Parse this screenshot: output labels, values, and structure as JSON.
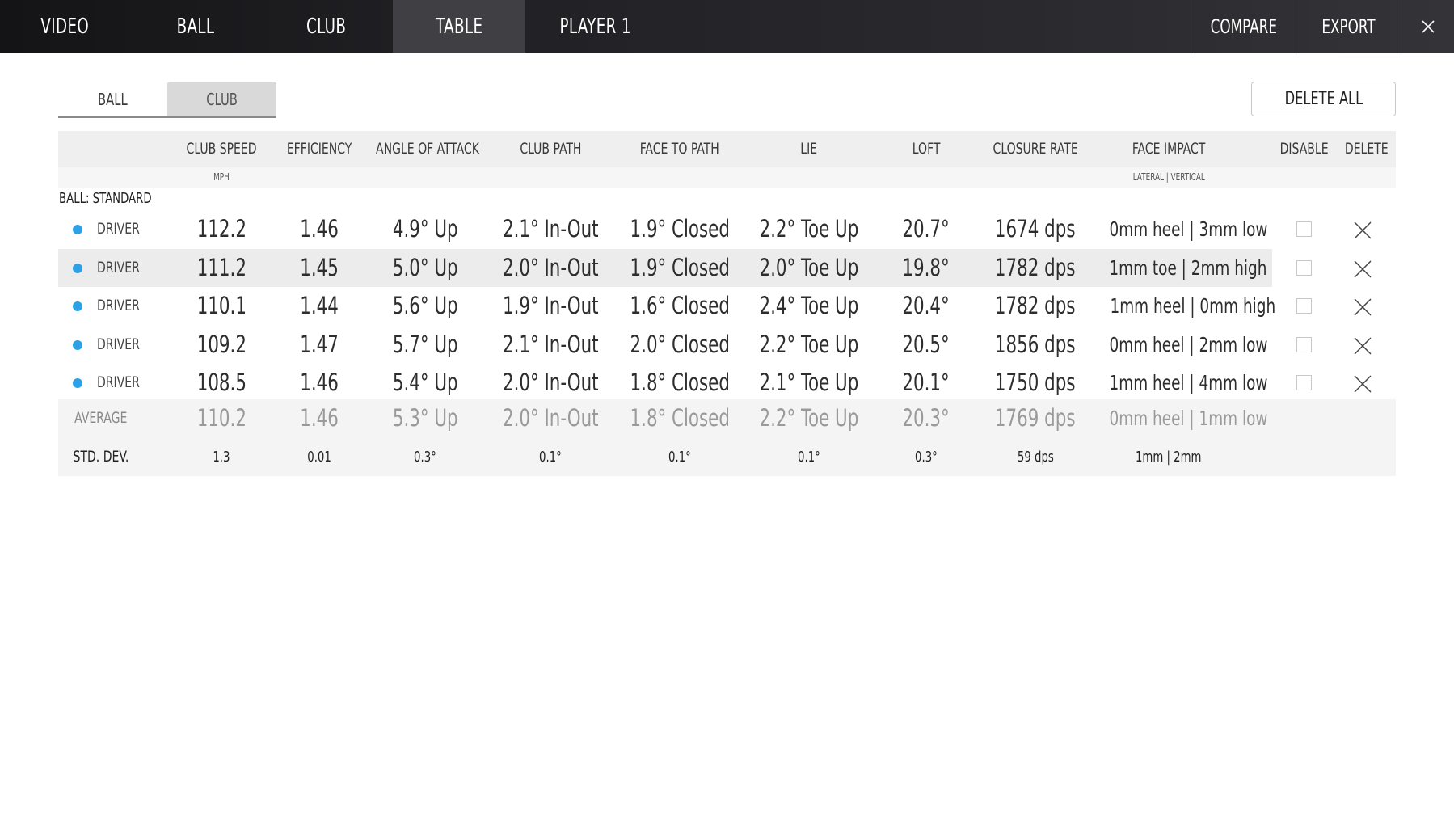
{
  "nav": {
    "tabs": [
      "VIDEO",
      "BALL",
      "CLUB",
      "TABLE",
      "PLAYER 1"
    ],
    "active": "TABLE",
    "compare": "COMPARE",
    "export": "EXPORT",
    "close_icon": "close-icon"
  },
  "subtabs": {
    "ball": "BALL",
    "club": "CLUB",
    "active": "CLUB"
  },
  "delete_all": "DELETE ALL",
  "table": {
    "headers": [
      "CLUB SPEED",
      "EFFICIENCY",
      "ANGLE OF ATTACK",
      "CLUB PATH",
      "FACE TO PATH",
      "LIE",
      "LOFT",
      "CLOSURE RATE",
      "FACE IMPACT",
      "DISABLE",
      "DELETE"
    ],
    "units": {
      "club_speed": "MPH",
      "face_impact": "LATERAL | VERTICAL"
    },
    "group": "BALL: STANDARD",
    "dot_color": "#2ba1e6",
    "rows": [
      {
        "club": "DRIVER",
        "club_speed": "112.2",
        "efficiency": "1.46",
        "aoa": "4.9° Up",
        "club_path": "2.1° In-Out",
        "face_to_path": "1.9° Closed",
        "lie": "2.2° Toe Up",
        "loft": "20.7°",
        "closure_rate": "1674 dps",
        "face_impact": "0mm heel | 3mm low"
      },
      {
        "club": "DRIVER",
        "club_speed": "111.2",
        "efficiency": "1.45",
        "aoa": "5.0° Up",
        "club_path": "2.0° In-Out",
        "face_to_path": "1.9° Closed",
        "lie": "2.0° Toe Up",
        "loft": "19.8°",
        "closure_rate": "1782 dps",
        "face_impact": "1mm toe | 2mm high"
      },
      {
        "club": "DRIVER",
        "club_speed": "110.1",
        "efficiency": "1.44",
        "aoa": "5.6° Up",
        "club_path": "1.9° In-Out",
        "face_to_path": "1.6° Closed",
        "lie": "2.4° Toe Up",
        "loft": "20.4°",
        "closure_rate": "1782 dps",
        "face_impact": "1mm heel | 0mm high"
      },
      {
        "club": "DRIVER",
        "club_speed": "109.2",
        "efficiency": "1.47",
        "aoa": "5.7° Up",
        "club_path": "2.1° In-Out",
        "face_to_path": "2.0° Closed",
        "lie": "2.2° Toe Up",
        "loft": "20.5°",
        "closure_rate": "1856 dps",
        "face_impact": "0mm heel | 2mm low"
      },
      {
        "club": "DRIVER",
        "club_speed": "108.5",
        "efficiency": "1.46",
        "aoa": "5.4° Up",
        "club_path": "2.0° In-Out",
        "face_to_path": "1.8° Closed",
        "lie": "2.1° Toe Up",
        "loft": "20.1°",
        "closure_rate": "1750 dps",
        "face_impact": "1mm heel | 4mm low"
      }
    ],
    "average": {
      "label": "AVERAGE",
      "club_speed": "110.2",
      "efficiency": "1.46",
      "aoa": "5.3° Up",
      "club_path": "2.0° In-Out",
      "face_to_path": "1.8° Closed",
      "lie": "2.2° Toe Up",
      "loft": "20.3°",
      "closure_rate": "1769 dps",
      "face_impact": "0mm heel | 1mm low"
    },
    "std_dev": {
      "label": "STD. DEV.",
      "club_speed": "1.3",
      "efficiency": "0.01",
      "aoa": "0.3°",
      "club_path": "0.1°",
      "face_to_path": "0.1°",
      "lie": "0.1°",
      "loft": "0.3°",
      "closure_rate": "59 dps",
      "face_impact": "1mm | 2mm"
    }
  }
}
